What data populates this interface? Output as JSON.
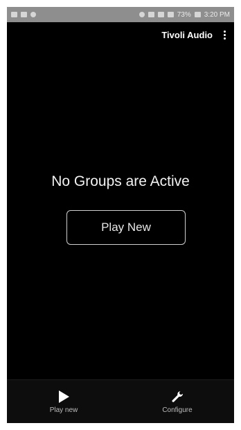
{
  "status_bar": {
    "battery": "73%",
    "time": "3:20 PM"
  },
  "header": {
    "title": "Tivoli Audio",
    "menu_icon": "more-vertical-icon"
  },
  "main": {
    "empty_title": "No Groups are Active",
    "play_new_label": "Play New"
  },
  "bottom_nav": {
    "items": [
      {
        "label": "Play new",
        "icon": "play-icon"
      },
      {
        "label": "Configure",
        "icon": "wrench-icon"
      }
    ]
  },
  "colors": {
    "background": "#000000",
    "text": "#ffffff",
    "status_bar": "#8e8e8e"
  }
}
